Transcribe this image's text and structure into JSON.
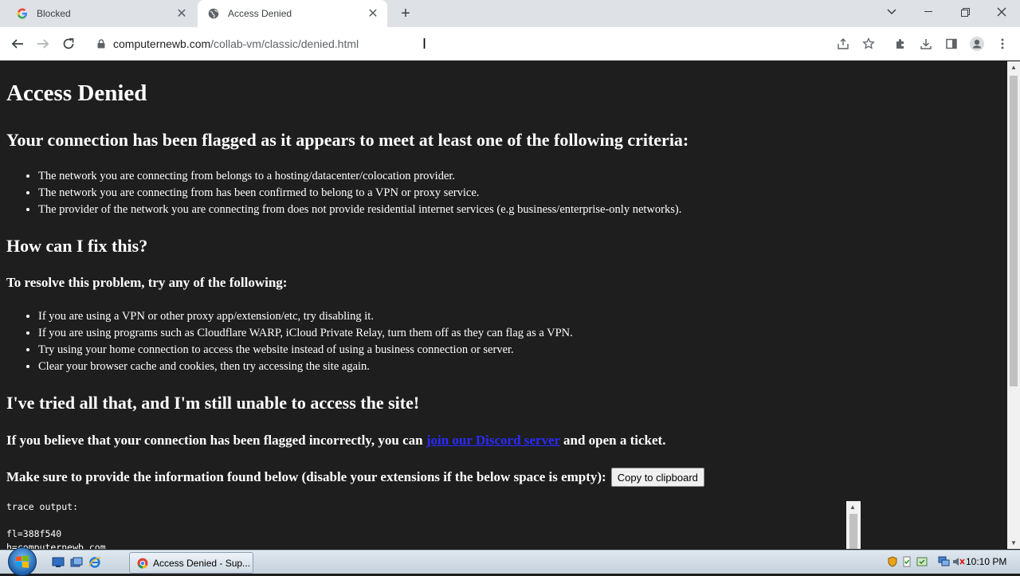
{
  "browser": {
    "tabs": [
      {
        "title": "Blocked",
        "favicon": "google-icon",
        "active": false
      },
      {
        "title": "Access Denied",
        "favicon": "globe-icon",
        "active": true
      }
    ],
    "url_host": "computernewb.com",
    "url_path": "/collab-vm/classic/denied.html"
  },
  "page": {
    "title": "Access Denied",
    "flag_heading": "Your connection has been flagged as it appears to meet at least one of the following criteria:",
    "criteria": [
      "The network you are connecting from belongs to a hosting/datacenter/colocation provider.",
      "The network you are connecting from has been confirmed to belong to a VPN or proxy service.",
      "The provider of the network you are connecting from does not provide residential internet services (e.g business/enterprise-only networks)."
    ],
    "fix_heading": "How can I fix this?",
    "resolve_heading": "To resolve this problem, try any of the following:",
    "fixes": [
      "If you are using a VPN or other proxy app/extension/etc, try disabling it.",
      "If you are using programs such as Cloudflare WARP, iCloud Private Relay, turn them off as they can flag as a VPN.",
      "Try using your home connection to access the website instead of using a business connection or server.",
      "Clear your browser cache and cookies, then try accessing the site again."
    ],
    "still_heading": "I've tried all that, and I'm still unable to access the site!",
    "incorrect_prefix": "If you believe that your connection has been flagged incorrectly, you can",
    "discord_link": "join our Discord server",
    "incorrect_suffix": "and open a ticket.",
    "provide_text": "Make sure to provide the information found below (disable your extensions if the below space is empty):",
    "copy_button": "Copy to clipboard",
    "trace_lines": [
      "trace output:",
      "",
      "fl=388f540",
      "h=computernewb.com"
    ]
  },
  "taskbar": {
    "task_button": "Access Denied - Sup...",
    "clock": "10:10 PM"
  }
}
